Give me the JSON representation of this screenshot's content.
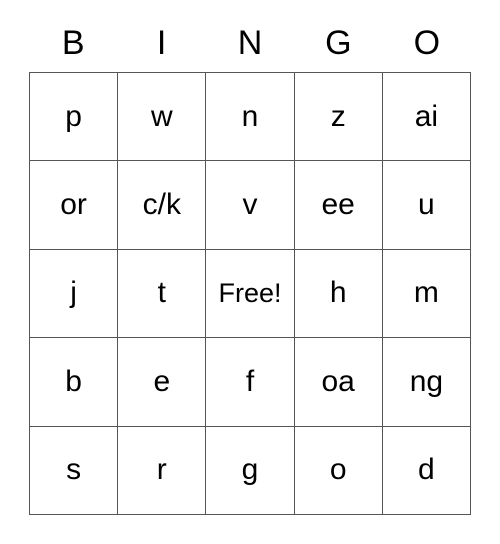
{
  "card": {
    "header": [
      "B",
      "I",
      "N",
      "G",
      "O"
    ],
    "rows": [
      [
        "p",
        "w",
        "n",
        "z",
        "ai"
      ],
      [
        "or",
        "c/k",
        "v",
        "ee",
        "u"
      ],
      [
        "j",
        "t",
        "Free!",
        "h",
        "m"
      ],
      [
        "b",
        "e",
        "f",
        "oa",
        "ng"
      ],
      [
        "s",
        "r",
        "g",
        "o",
        "d"
      ]
    ],
    "free_space": {
      "row": 2,
      "column": 2,
      "label": "Free!"
    },
    "colors": {
      "background": "#ffffff",
      "grid_line": "#555555",
      "text": "#000000"
    }
  }
}
